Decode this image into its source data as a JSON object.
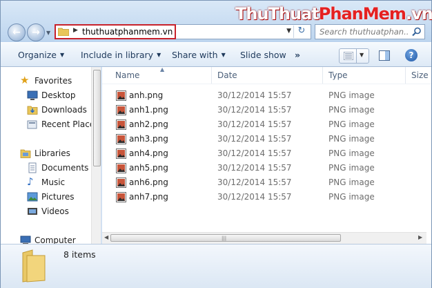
{
  "watermark": {
    "part1": "ThuThuat",
    "part2": "PhanMem",
    "part3": ".vn"
  },
  "address": {
    "path": "thuthuatphanmem.vn"
  },
  "search": {
    "placeholder": "Search thuthuatphan..."
  },
  "toolbar": {
    "organize": "Organize",
    "include_in_library": "Include in library",
    "share_with": "Share with",
    "slide_show": "Slide show",
    "more": "»"
  },
  "nav": {
    "favorites": "Favorites",
    "desktop": "Desktop",
    "downloads": "Downloads",
    "recent_places": "Recent Places",
    "libraries": "Libraries",
    "documents": "Documents",
    "music": "Music",
    "pictures": "Pictures",
    "videos": "Videos",
    "computer": "Computer"
  },
  "columns": {
    "name": "Name",
    "date": "Date",
    "type": "Type",
    "size": "Size"
  },
  "files": [
    {
      "name": "anh.png",
      "date": "30/12/2014 15:57",
      "type": "PNG image"
    },
    {
      "name": "anh1.png",
      "date": "30/12/2014 15:57",
      "type": "PNG image"
    },
    {
      "name": "anh2.png",
      "date": "30/12/2014 15:57",
      "type": "PNG image"
    },
    {
      "name": "anh3.png",
      "date": "30/12/2014 15:57",
      "type": "PNG image"
    },
    {
      "name": "anh4.png",
      "date": "30/12/2014 15:57",
      "type": "PNG image"
    },
    {
      "name": "anh5.png",
      "date": "30/12/2014 15:57",
      "type": "PNG image"
    },
    {
      "name": "anh6.png",
      "date": "30/12/2014 15:57",
      "type": "PNG image"
    },
    {
      "name": "anh7.png",
      "date": "30/12/2014 15:57",
      "type": "PNG image"
    }
  ],
  "details": {
    "count": "8 items"
  },
  "colors": {
    "highlight_border": "#c8202a",
    "watermark_red": "#e52121"
  }
}
